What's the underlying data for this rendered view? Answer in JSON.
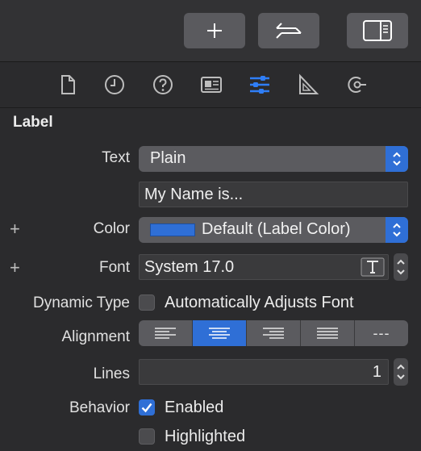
{
  "colors": {
    "accent": "#2f6fd6",
    "label_swatch": "#2f6fd6"
  },
  "toolbar": {
    "buttons": [
      {
        "icon": "plus-icon"
      },
      {
        "icon": "swap-arrows-icon"
      },
      {
        "icon": "inspector-panel-icon"
      }
    ]
  },
  "inspector_tabs": [
    {
      "icon": "file-icon"
    },
    {
      "icon": "history-icon"
    },
    {
      "icon": "help-icon"
    },
    {
      "icon": "identity-icon"
    },
    {
      "icon": "attributes-icon",
      "selected": true
    },
    {
      "icon": "size-icon"
    },
    {
      "icon": "connections-icon"
    }
  ],
  "section": {
    "title": "Label"
  },
  "rows": {
    "text": {
      "label": "Text",
      "value": "Plain"
    },
    "text_content": {
      "value": "My Name is..."
    },
    "color": {
      "label": "Color",
      "value": "Default (Label Color)",
      "plus": "+"
    },
    "font": {
      "label": "Font",
      "value": "System 17.0",
      "plus": "+"
    },
    "dynamic_type": {
      "label": "Dynamic Type",
      "checkbox_label": "Automatically Adjusts Font",
      "checked": false
    },
    "alignment": {
      "label": "Alignment",
      "options": [
        "left",
        "center",
        "right",
        "justified",
        "natural"
      ],
      "selected": "center",
      "natural_glyph": "---"
    },
    "lines": {
      "label": "Lines",
      "value": "1"
    },
    "behavior": {
      "label": "Behavior",
      "enabled": {
        "label": "Enabled",
        "checked": true
      },
      "highlighted": {
        "label": "Highlighted",
        "checked": false
      }
    }
  }
}
